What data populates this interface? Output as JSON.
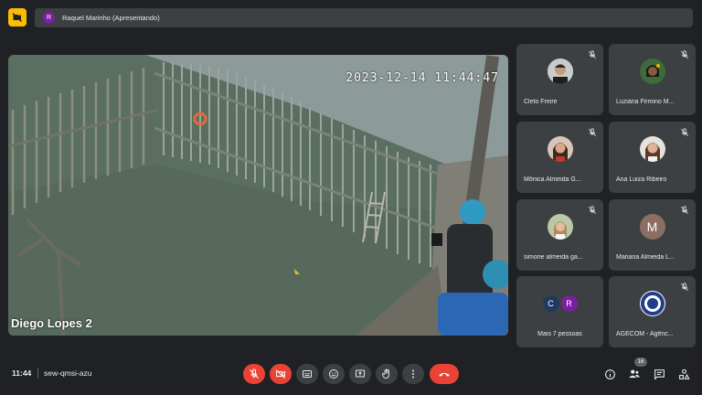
{
  "top": {
    "presenter_initial": "R",
    "presenter_label": "Raquel Marinho (Apresentando)"
  },
  "stage": {
    "name": "Diego Lopes 2",
    "timestamp": "2023-12-14  11:44:47"
  },
  "tiles": [
    {
      "name": "Cleto Freire"
    },
    {
      "name": "Luziária Firmino M..."
    },
    {
      "name": "Mônica Almeida G..."
    },
    {
      "name": "Ana Luiza Ribeiro"
    },
    {
      "name": "simone almeida ga..."
    },
    {
      "name": "Mariana Almeida L...",
      "initial": "M"
    },
    {
      "name": "Mais 7 pessoas",
      "initial_a": "C",
      "initial_b": "R"
    },
    {
      "name": "AGECOM - Agênc..."
    }
  ],
  "bottom": {
    "clock": "11:44",
    "meeting_code": "sew-qmsi-azu",
    "people_count": "16"
  },
  "colors": {
    "background": "#202124",
    "tile": "#3c4043",
    "end_call_red": "#ea4335",
    "camera_off_yellow": "#fbbc04",
    "presenter_purple": "#7b1fa2",
    "mariana_brown": "#8d6e63",
    "c_blue": "#1e3a5f"
  },
  "icons": [
    "camera-off-icon",
    "mic-off-icon",
    "camera-off-icon",
    "captions-icon",
    "emoji-icon",
    "present-icon",
    "raise-hand-icon",
    "more-options-icon",
    "end-call-icon",
    "info-icon",
    "people-icon",
    "chat-icon",
    "activities-icon"
  ]
}
